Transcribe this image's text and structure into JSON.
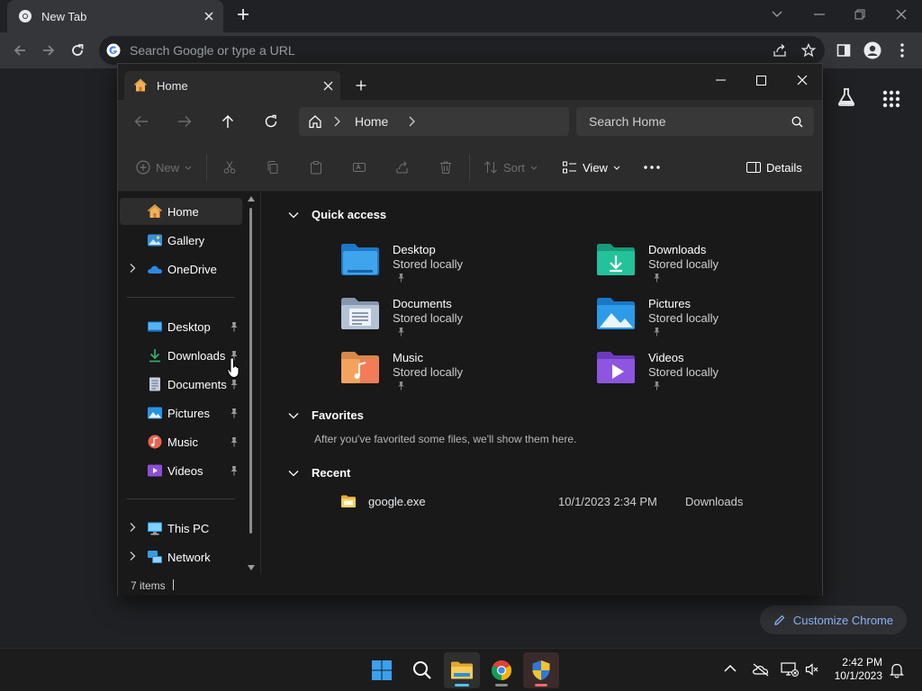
{
  "chrome": {
    "tab_title": "New Tab",
    "omnibox_placeholder": "Search Google or type a URL",
    "customize_label": "Customize Chrome"
  },
  "explorer": {
    "tab_title": "Home",
    "breadcrumb": [
      "Home"
    ],
    "search_placeholder": "Search Home",
    "toolbar": {
      "new_label": "New",
      "sort_label": "Sort",
      "view_label": "View",
      "details_label": "Details"
    },
    "sidebar": {
      "top": [
        {
          "label": "Home",
          "icon": "home-icon",
          "selected": true
        },
        {
          "label": "Gallery",
          "icon": "gallery-icon"
        },
        {
          "label": "OneDrive",
          "icon": "onedrive-icon",
          "expandable": true
        }
      ],
      "pinned": [
        {
          "label": "Desktop",
          "icon": "desktop-folder-icon"
        },
        {
          "label": "Downloads",
          "icon": "downloads-icon"
        },
        {
          "label": "Documents",
          "icon": "documents-icon"
        },
        {
          "label": "Pictures",
          "icon": "pictures-icon"
        },
        {
          "label": "Music",
          "icon": "music-icon"
        },
        {
          "label": "Videos",
          "icon": "videos-icon"
        }
      ],
      "bottom": [
        {
          "label": "This PC",
          "icon": "this-pc-icon"
        },
        {
          "label": "Network",
          "icon": "network-icon"
        }
      ]
    },
    "sections": {
      "quick_access": "Quick access",
      "favorites": "Favorites",
      "recent": "Recent"
    },
    "quick_access": [
      {
        "name": "Desktop",
        "sub": "Stored locally",
        "icon": "desktop-folder-icon"
      },
      {
        "name": "Downloads",
        "sub": "Stored locally",
        "icon": "downloads-folder-icon"
      },
      {
        "name": "Documents",
        "sub": "Stored locally",
        "icon": "documents-folder-icon"
      },
      {
        "name": "Pictures",
        "sub": "Stored locally",
        "icon": "pictures-folder-icon"
      },
      {
        "name": "Music",
        "sub": "Stored locally",
        "icon": "music-folder-icon"
      },
      {
        "name": "Videos",
        "sub": "Stored locally",
        "icon": "videos-folder-icon"
      }
    ],
    "favorites_empty": "After you've favorited some files, we'll show them here.",
    "recent": [
      {
        "name": "google.exe",
        "date": "10/1/2023 2:34 PM",
        "location": "Downloads"
      }
    ],
    "status": "7 items"
  },
  "taskbar": {
    "time": "2:42 PM",
    "date": "10/1/2023"
  },
  "colors": {
    "chrome_bg": "#202124",
    "explorer_bg": "#191919",
    "accent": "#4cc2ff",
    "link_blue": "#8ab4f8"
  }
}
